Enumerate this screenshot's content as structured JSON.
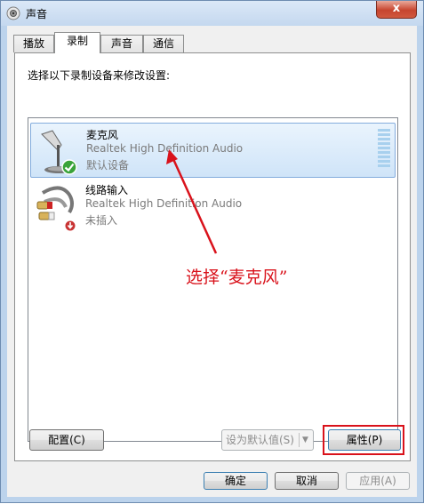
{
  "window": {
    "title": "声音",
    "close_label": "x"
  },
  "tabs": [
    {
      "label": "播放",
      "active": false
    },
    {
      "label": "录制",
      "active": true
    },
    {
      "label": "声音",
      "active": false
    },
    {
      "label": "通信",
      "active": false
    }
  ],
  "panel": {
    "instruction": "选择以下录制设备来修改设置:",
    "devices": [
      {
        "name": "麦克风",
        "description": "Realtek High Definition Audio",
        "status": "默认设备",
        "icon": "microphone-icon",
        "badge": "check-icon",
        "selected": true,
        "level_indicator": "level-meter"
      },
      {
        "name": "线路输入",
        "description": "Realtek High Definition Audio",
        "status": "未插入",
        "icon": "line-in-cable-icon",
        "badge": "unplugged-icon",
        "selected": false
      }
    ],
    "configure_button": "配置(C)",
    "set_default_button": "设为默认值(S)",
    "properties_button": "属性(P)"
  },
  "footer": {
    "ok_button": "确定",
    "cancel_button": "取消",
    "apply_button": "应用(A)"
  },
  "annotation": {
    "text": "选择“麦克风”",
    "color": "#d9121b"
  }
}
